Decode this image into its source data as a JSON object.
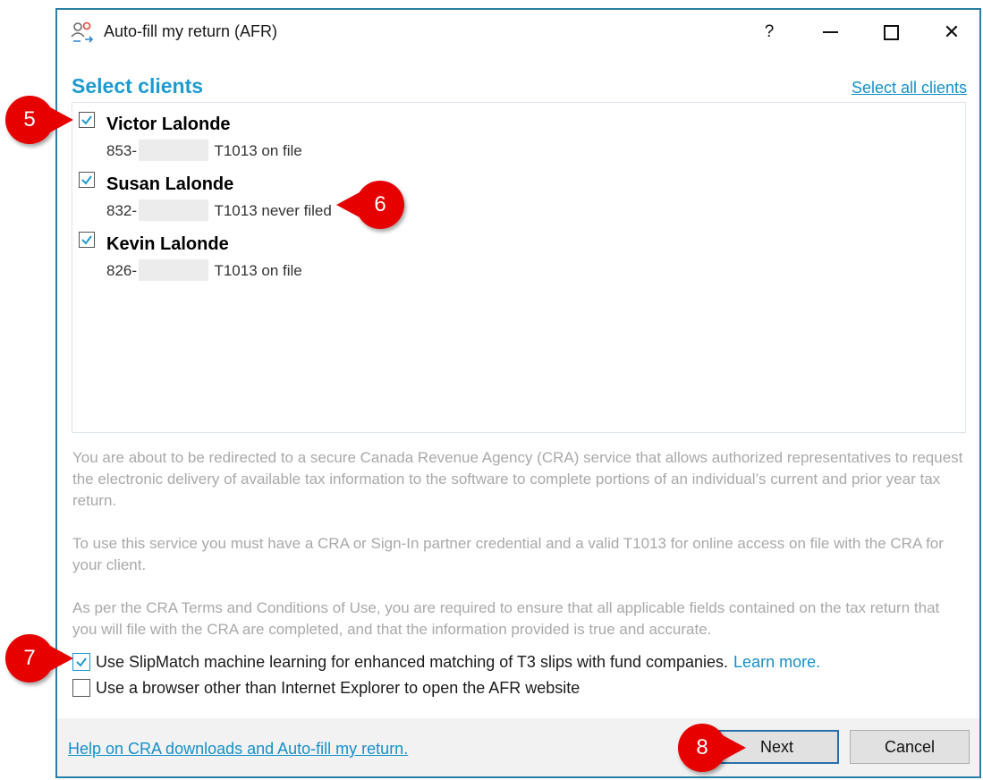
{
  "window": {
    "title": "Auto-fill my return (AFR)",
    "help_glyph": "?",
    "maximize_glyph": "☐",
    "close_glyph": "✕",
    "icon": "users-transfer-icon"
  },
  "header": {
    "title": "Select clients",
    "select_all": "Select all clients"
  },
  "clients": [
    {
      "name": "Victor Lalonde",
      "sin_prefix": "853-",
      "status": "T1013 on file",
      "checked": true
    },
    {
      "name": "Susan Lalonde",
      "sin_prefix": "832-",
      "status": "T1013 never filed",
      "checked": true
    },
    {
      "name": "Kevin Lalonde",
      "sin_prefix": "826-",
      "status": "T1013 on file",
      "checked": true
    }
  ],
  "info": {
    "p1": "You are about to be redirected to a secure Canada Revenue Agency (CRA) service that allows authorized representatives to request the electronic delivery of available tax information to the software to complete portions of an individual’s current and prior year tax return.",
    "p2": "To use this service you must have a CRA or Sign-In partner credential and a valid T1013 for online access on file with the CRA for your client.",
    "p3": "As per the CRA Terms and Conditions of Use, you are required to ensure that all applicable fields contained on the tax return that you will file with the CRA are completed, and that the information provided is true and accurate."
  },
  "options": {
    "slipmatch": {
      "label": "Use SlipMatch machine learning for enhanced matching of T3 slips with fund companies.",
      "link": "Learn more.",
      "checked": true
    },
    "browser": {
      "label": "Use a browser other than Internet Explorer to open the AFR website",
      "checked": false
    }
  },
  "footer": {
    "help_link": "Help on CRA downloads and Auto-fill my return.",
    "next": "Next",
    "cancel": "Cancel"
  },
  "callouts": [
    "5",
    "6",
    "7",
    "8"
  ],
  "colors": {
    "accent": "#1d9bd1",
    "link": "#1490c8",
    "window_border": "#2a7fa6",
    "callout": "#e60000",
    "muted_text": "#a9a9a9"
  }
}
